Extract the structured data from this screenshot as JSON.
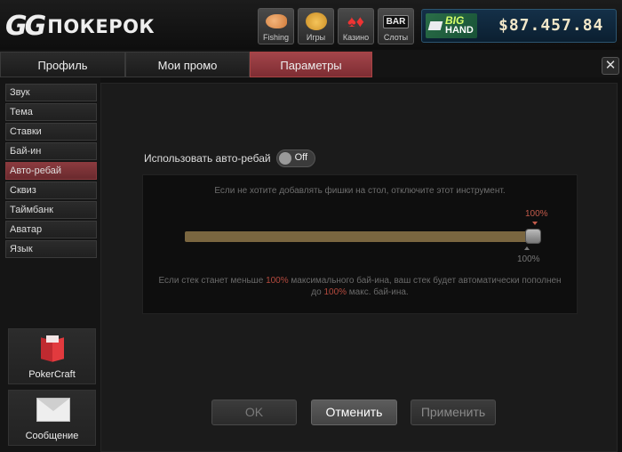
{
  "header": {
    "logo_gg": "GG",
    "logo_text": "ПОКЕРОК",
    "games": [
      {
        "label": "Fishing",
        "icon": "fish-icon"
      },
      {
        "label": "Игры",
        "icon": "cat-icon"
      },
      {
        "label": "Казино",
        "icon": "cards-icon"
      },
      {
        "label": "Слоты",
        "icon": "bar-slot-icon",
        "badge": "BAR"
      }
    ],
    "bighand": {
      "big": "BIG",
      "hand": "HAND"
    },
    "balance": "$87.457.84"
  },
  "tabs": [
    {
      "label": "Профиль",
      "active": false
    },
    {
      "label": "Мои промо",
      "active": false
    },
    {
      "label": "Параметры",
      "active": true
    }
  ],
  "close_label": "✕",
  "sidebar": {
    "items": [
      {
        "label": "Звук",
        "active": false
      },
      {
        "label": "Тема",
        "active": false
      },
      {
        "label": "Ставки",
        "active": false
      },
      {
        "label": "Бай-ин",
        "active": false
      },
      {
        "label": "Авто-ребай",
        "active": true
      },
      {
        "label": "Сквиз",
        "active": false
      },
      {
        "label": "Таймбанк",
        "active": false
      },
      {
        "label": "Аватар",
        "active": false
      },
      {
        "label": "Язык",
        "active": false
      }
    ],
    "pokercraft_label": "PokerCraft",
    "message_label": "Сообщение"
  },
  "settings": {
    "toggle_label": "Использовать авто-ребай",
    "toggle_state": "Off",
    "hint": "Если не хотите добавлять фишки на стол, отключите этот инструмент.",
    "slider_top_label": "100%",
    "slider_bottom_label": "100%",
    "slider_value_percent": 100,
    "info_line1_a": "Если стек станет меньше ",
    "info_line1_hl": "100%",
    "info_line1_b": " максимального бай-ина, ваш стек будет автоматически пополнен",
    "info_line2_a": "до ",
    "info_line2_hl": "100%",
    "info_line2_b": " макс. бай-ина."
  },
  "buttons": {
    "ok": "OK",
    "cancel": "Отменить",
    "apply": "Применить"
  },
  "colors": {
    "accent_tab": "#9a3f45",
    "slider_track": "#7a6640",
    "highlight_text": "#b44a3e"
  }
}
